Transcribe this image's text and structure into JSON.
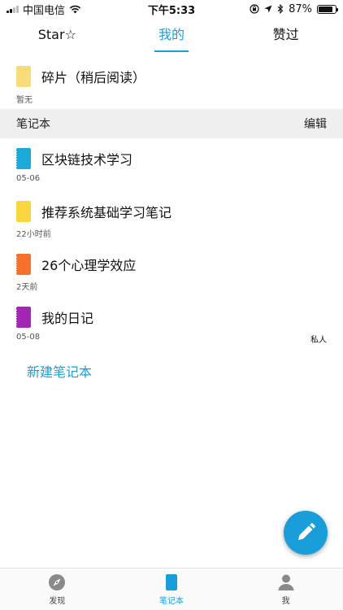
{
  "status_bar": {
    "carrier": "中国电信",
    "time": "下午5:33",
    "battery_percent": "87%",
    "battery_level": 0.87
  },
  "tabs": [
    {
      "label": "Star☆",
      "active": false
    },
    {
      "label": "我的",
      "active": true
    },
    {
      "label": "赞过",
      "active": false
    }
  ],
  "fragments": {
    "title": "碎片（稍后阅读）",
    "meta": "暂无",
    "icon_color": "#f8dc7a"
  },
  "section": {
    "title": "笔记本",
    "edit_label": "编辑"
  },
  "notebooks": [
    {
      "title": "区块链技术学习",
      "date": "05-06",
      "badge": "",
      "color": "#1aa9d9"
    },
    {
      "title": "推荐系统基础学习笔记",
      "date": "22小时前",
      "badge": "",
      "color": "#fad53e"
    },
    {
      "title": "26个心理学效应",
      "date": "2天前",
      "badge": "",
      "color": "#f7712a"
    },
    {
      "title": "我的日记",
      "date": "05-08",
      "badge": "私人",
      "color": "#a225b4"
    }
  ],
  "new_notebook_label": "新建笔记本",
  "bottom_nav": [
    {
      "label": "发现",
      "icon": "compass-icon",
      "active": false
    },
    {
      "label": "笔记本",
      "icon": "notebook-icon",
      "active": true
    },
    {
      "label": "我",
      "icon": "person-icon",
      "active": false
    }
  ],
  "colors": {
    "accent": "#1a9ed9"
  }
}
